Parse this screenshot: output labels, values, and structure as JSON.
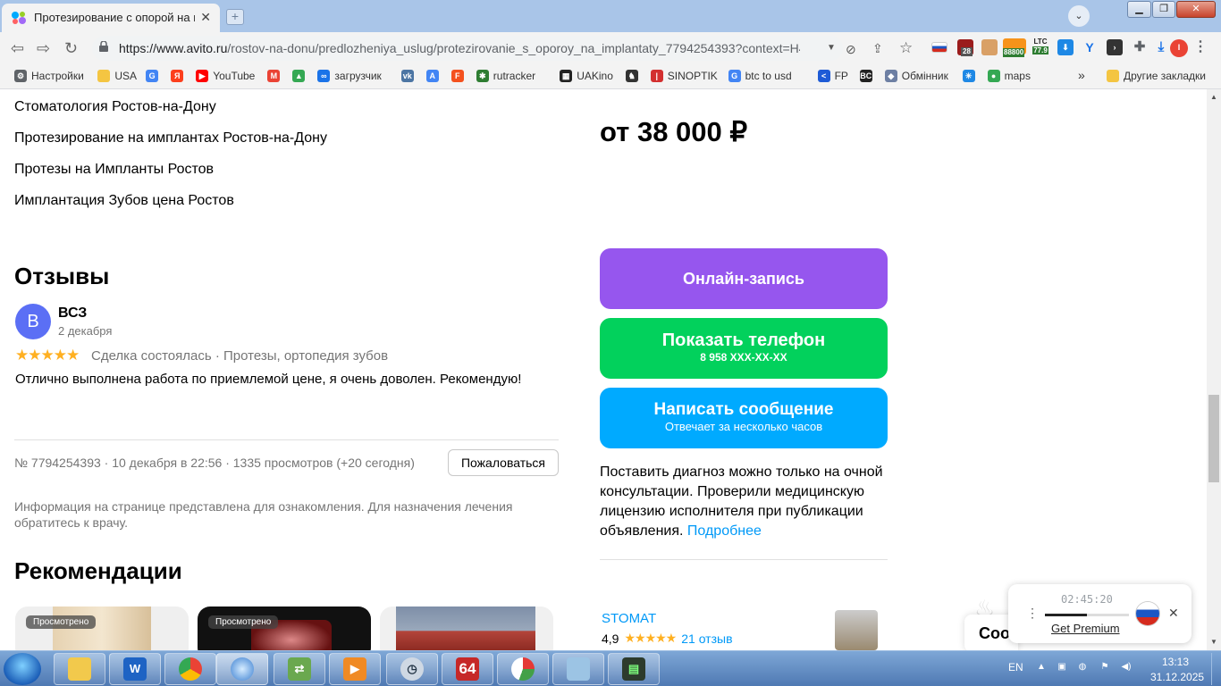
{
  "browser": {
    "tab_title": "Протезирование с опорой на им",
    "url_host": "https://www.avito.ru",
    "url_path": "/rostov-na-donu/predlozheniya_uslug/protezirovanie_s_oporoy_na_implantaty_7794254393?context=H4sI...",
    "ext_badges": {
      "badge_28": "28",
      "btc_price": "88800",
      "ltc_label": "LTC",
      "ltc_price": "77.9",
      "profile_letter": "I"
    },
    "bookmarks": [
      {
        "label": "Настройки",
        "icon": "gear-icon",
        "color": "#5f6368"
      },
      {
        "label": "USA",
        "icon": "folder-icon",
        "color": "#f4c542"
      },
      {
        "label": "",
        "icon": "google-icon",
        "color": "#4285f4"
      },
      {
        "label": "",
        "icon": "yandex-icon",
        "color": "#fc3f1d"
      },
      {
        "label": "YouTube",
        "icon": "youtube-icon",
        "color": "#ff0000"
      },
      {
        "label": "",
        "icon": "gmail-icon",
        "color": "#ea4335"
      },
      {
        "label": "",
        "icon": "drive-icon",
        "color": "#34a853"
      },
      {
        "label": "загрузчик",
        "icon": "infinity-icon",
        "color": "#1a73e8"
      },
      {
        "label": "",
        "icon": "vk-icon",
        "color": "#4c75a3"
      },
      {
        "label": "",
        "icon": "translate-icon",
        "color": "#4285f4"
      },
      {
        "label": "",
        "icon": "f-icon",
        "color": "#f4511e"
      },
      {
        "label": "rutracker",
        "icon": "rutracker-icon",
        "color": "#2e7d32"
      },
      {
        "label": "UAKino",
        "icon": "uakino-icon",
        "color": "#222222"
      },
      {
        "label": "",
        "icon": "chess-icon",
        "color": "#333333"
      },
      {
        "label": "SINOPTIK",
        "icon": "thermometer-icon",
        "color": "#d32f2f"
      },
      {
        "label": "btc to usd",
        "icon": "google-icon",
        "color": "#4285f4"
      },
      {
        "label": "FP",
        "icon": "fp-icon",
        "color": "#1e5bd6"
      },
      {
        "label": "",
        "icon": "bc-icon",
        "color": "#222222"
      },
      {
        "label": "Обмінник",
        "icon": "exchange-icon",
        "color": "#6d7fa3"
      },
      {
        "label": "",
        "icon": "star-icon",
        "color": "#1e88e5"
      },
      {
        "label": "maps",
        "icon": "maps-icon",
        "color": "#34a853"
      }
    ],
    "other_bookmarks": "Другие закладки",
    "more": "»"
  },
  "page": {
    "links": [
      "Стоматология Ростов-на-Дону",
      "Протезирование на имплантах Ростов-на-Дону",
      "Протезы на Импланты Ростов",
      "Имплантация Зубов цена Ростов"
    ],
    "price": "от 38 000 ₽",
    "reviews_heading": "Отзывы",
    "review": {
      "avatar_letter": "В",
      "author": "ВСЗ",
      "date": "2 декабря",
      "rating": 5,
      "stars": "★★★★★",
      "meta": "Сделка состоялась · Протезы, ортопедия зубов",
      "text": "Отлично выполнена работа по приемлемой цене, я очень доволен. Рекомендую!"
    },
    "item_info": "№ 7794254393 · 10 декабря в 22:56 · 1335 просмотров (+20 сегодня)",
    "complain_button": "Пожаловаться",
    "disclaimer": "Информация на странице представлена для ознакомления. Для назначения лечения обратитесь к врачу.",
    "recommendations_heading": "Рекомендации",
    "viewed_badge": "Просмотрено",
    "online_booking": "Онлайн-запись",
    "show_phone": "Показать телефон",
    "phone_masked": "8 958 XXX-XX-XX",
    "write_message": "Написать сообщение",
    "reply_time": "Отвечает за несколько часов",
    "diagnosis_text": "Поставить диагноз можно только на очной консультации. Проверили медицинскую лицензию исполнителя при публикации объявления.",
    "diagnosis_link": "Подробнее",
    "seller_name": "STOMAT",
    "seller_rating": "4,9",
    "seller_reviews": "21 отзыв",
    "cookie_partial": "Coo",
    "colors": {
      "booking": "#9656ee",
      "phone": "#02d15c",
      "message": "#00aaff"
    }
  },
  "vpn_widget": {
    "timer": "02:45:20",
    "premium": "Get Premium",
    "progress": 0.5
  },
  "taskbar": {
    "lang": "EN",
    "time": "13:13",
    "date": "31.12.2025",
    "app_64": "64"
  }
}
